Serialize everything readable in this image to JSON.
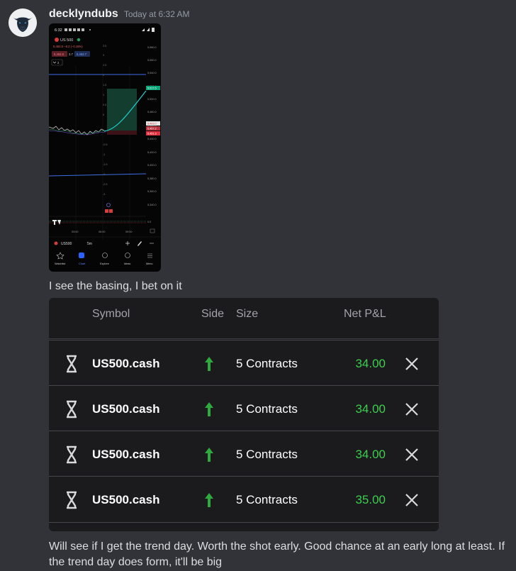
{
  "message": {
    "username": "decklyndubs",
    "timestamp": "Today at 6:32 AM",
    "text1": "I see the basing, I bet on it",
    "text2": "Will see if I get the trend day. Worth the shot early. Good chance at an early long at least. If the trend day does form, it'll be big"
  },
  "phone": {
    "status_time": "6:32",
    "symbol": "US 500",
    "price_line": "5,463.5 −8.2 (−0.15%)",
    "bid": "5,463.5",
    "spread": "3.7",
    "ask": "5,463.7",
    "indicator_count": "2",
    "price_axis": [
      "5,580.0",
      "5,560.0",
      "5,540.0",
      "5,520.0",
      "5,500.0",
      "5,480.0",
      "5,460.0",
      "5,440.0",
      "5,420.0",
      "5,400.0",
      "5,380.0",
      "5,360.0",
      "5,340.0"
    ],
    "price_tags": [
      "5,517.5",
      "5,463.0",
      "5,457.2",
      "5,451.3"
    ],
    "left_axis": [
      "3.5",
      "3",
      "2.5",
      "2",
      "1.5",
      "1",
      "0.5",
      "0",
      "-0.5",
      "-1",
      "-1.5",
      "-2",
      "-2.5",
      "-3"
    ],
    "lower_axis": "0.0",
    "time_axis": [
      "03:00",
      "06:00",
      "09:00"
    ],
    "ticker": "US500",
    "interval": "5m",
    "nav": [
      "Watchlist",
      "Chart",
      "Explore",
      "Ideas",
      "Menu"
    ]
  },
  "table": {
    "headers": {
      "symbol": "Symbol",
      "side": "Side",
      "size": "Size",
      "pnl": "Net P&L"
    },
    "rows": [
      {
        "symbol": "US500.cash",
        "size": "5 Contracts",
        "pnl": "34.00"
      },
      {
        "symbol": "US500.cash",
        "size": "5 Contracts",
        "pnl": "34.00"
      },
      {
        "symbol": "US500.cash",
        "size": "5 Contracts",
        "pnl": "34.00"
      },
      {
        "symbol": "US500.cash",
        "size": "5 Contracts",
        "pnl": "35.00"
      }
    ],
    "colors": {
      "profit": "#3ccf4e",
      "side_up": "#2eaa3e"
    }
  }
}
